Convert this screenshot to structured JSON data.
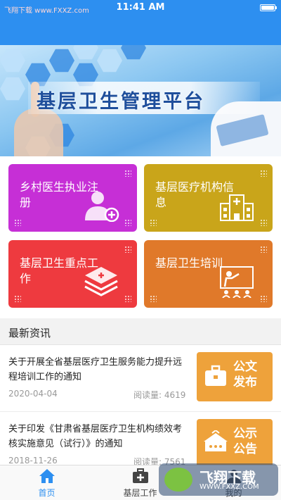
{
  "status_bar": {
    "watermark": "飞翔下载 www.FXXZ.com",
    "time": "11:41 AM",
    "battery_level": 1.0,
    "color": "#2d8ff0"
  },
  "banner": {
    "title": "基层卫生管理平台"
  },
  "grid": {
    "cards": [
      {
        "label": "乡村医生执业注册",
        "icon": "doctor-add-icon",
        "color": "#c62fd6"
      },
      {
        "label": "基层医疗机构信息",
        "icon": "hospital-building-icon",
        "color": "#c9a51a"
      },
      {
        "label": "基层卫生重点工作",
        "icon": "medical-layers-icon",
        "color": "#ee3a3f"
      },
      {
        "label": "基层卫生培训",
        "icon": "teacher-board-icon",
        "color": "#e0792a"
      }
    ]
  },
  "news_section": {
    "title": "最新资讯",
    "items": [
      {
        "title": "关于开展全省基层医疗卫生服务能力提升远程培训工作的通知",
        "date": "2020-04-04",
        "reads_label": "阅读量:",
        "reads": "4619",
        "thumb_text": "公文发布",
        "thumb_icon": "briefcase-icon"
      },
      {
        "title": "关于印发《甘肃省基层医疗卫生机构绩效考核实施意见（试行）》的通知",
        "date": "2018-11-26",
        "reads_label": "阅读量:",
        "reads": "7561",
        "thumb_text": "公示公告",
        "thumb_icon": "notice-board-icon"
      }
    ]
  },
  "tab_bar": {
    "tabs": [
      {
        "label": "首页",
        "icon": "home-icon",
        "active": true
      },
      {
        "label": "基层工作",
        "icon": "medical-kit-icon",
        "active": false
      },
      {
        "label": "我的",
        "icon": "user-icon",
        "active": false
      }
    ]
  },
  "watermark_badge": {
    "big": "飞翔下载",
    "small": "WWW.FXXZ.COM"
  },
  "colors": {
    "accent": "#2d8ff0",
    "thumb": "#eea23b"
  }
}
